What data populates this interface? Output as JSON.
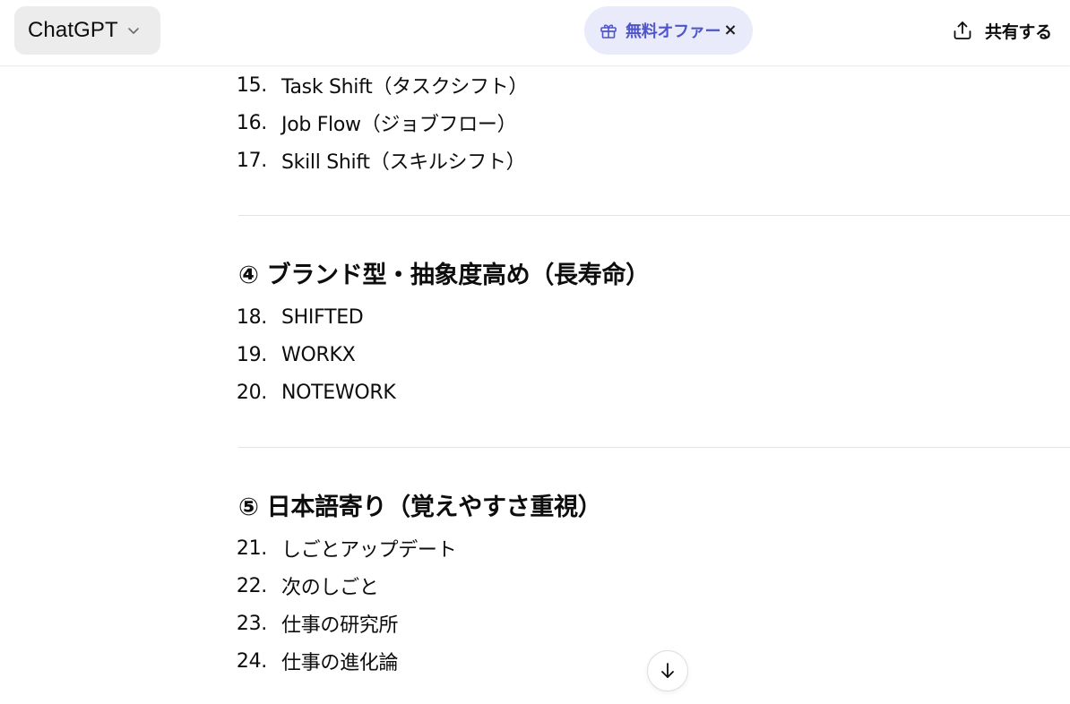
{
  "header": {
    "model_name": "ChatGPT",
    "offer_label": "無料オファー",
    "offer_close": "×",
    "share_label": "共有する"
  },
  "sections": [
    {
      "heading": "",
      "items": [
        {
          "num": "15.",
          "text": "Task Shift（タスクシフト）"
        },
        {
          "num": "16.",
          "text": "Job Flow（ジョブフロー）"
        },
        {
          "num": "17.",
          "text": "Skill Shift（スキルシフト）"
        }
      ]
    },
    {
      "heading": "④ ブランド型・抽象度高め（長寿命）",
      "items": [
        {
          "num": "18.",
          "text": "SHIFTED"
        },
        {
          "num": "19.",
          "text": "WORKX"
        },
        {
          "num": "20.",
          "text": "NOTEWORK"
        }
      ]
    },
    {
      "heading": "⑤ 日本語寄り（覚えやすさ重視）",
      "items": [
        {
          "num": "21.",
          "text": "しごとアップデート"
        },
        {
          "num": "22.",
          "text": "次のしごと"
        },
        {
          "num": "23.",
          "text": "仕事の研究所"
        },
        {
          "num": "24.",
          "text": "仕事の進化論"
        }
      ]
    }
  ],
  "icons": {
    "model_chevron": "chevron-down-icon",
    "offer": "gift-icon",
    "share": "share-icon",
    "scroll": "arrow-down-icon"
  },
  "colors": {
    "offer_bg": "#e9ebfb",
    "offer_text": "#4f55c9",
    "model_bg": "#ececec"
  }
}
